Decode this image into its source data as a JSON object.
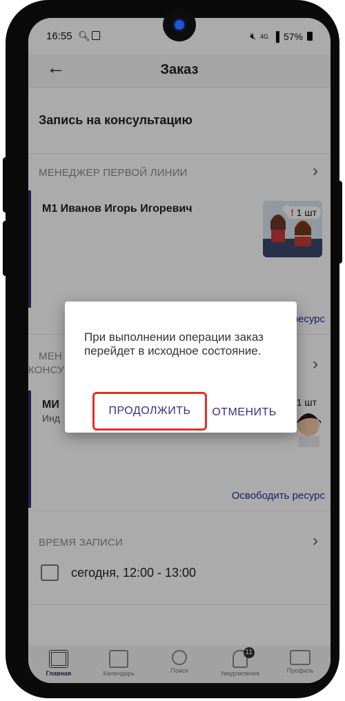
{
  "status": {
    "time": "16:55",
    "battery": "57%",
    "network": "4G"
  },
  "header": {
    "title": "Заказ"
  },
  "section": {
    "title": "Запись на консультацию"
  },
  "items": [
    {
      "caption": "МЕНЕДЖЕР ПЕРВОЙ ЛИНИИ",
      "name": "М1 Иванов Игорь Игоревич",
      "quantity": "1 шт",
      "release": "Освободить ресурс"
    },
    {
      "caption_line1": "МЕН",
      "caption_line2": "КОНСУ",
      "name": "МИ",
      "subtitle": "Инд",
      "quantity": "1 шт",
      "release": "Освободить ресурс"
    }
  ],
  "time_block": {
    "caption": "ВРЕМЯ ЗАПИСИ",
    "value": "сегодня, 12:00 - 13:00"
  },
  "dialog": {
    "message": "При выполнении операции заказ перейдет в исходное состояние.",
    "continue_label": "ПРОДОЛЖИТЬ",
    "cancel_label": "ОТМЕНИТЬ"
  },
  "nav": [
    {
      "label": "Главная",
      "icon": "grid-icon"
    },
    {
      "label": "Календарь",
      "icon": "calendar-icon"
    },
    {
      "label": "Поиск",
      "icon": "search-icon"
    },
    {
      "label": "Уведомления",
      "icon": "bell-icon",
      "badge": "11"
    },
    {
      "label": "Профиль",
      "icon": "profile-icon"
    }
  ],
  "colors": {
    "accent": "#3b2d8a",
    "highlight": "#e0302b",
    "link": "#1e2f9a"
  }
}
